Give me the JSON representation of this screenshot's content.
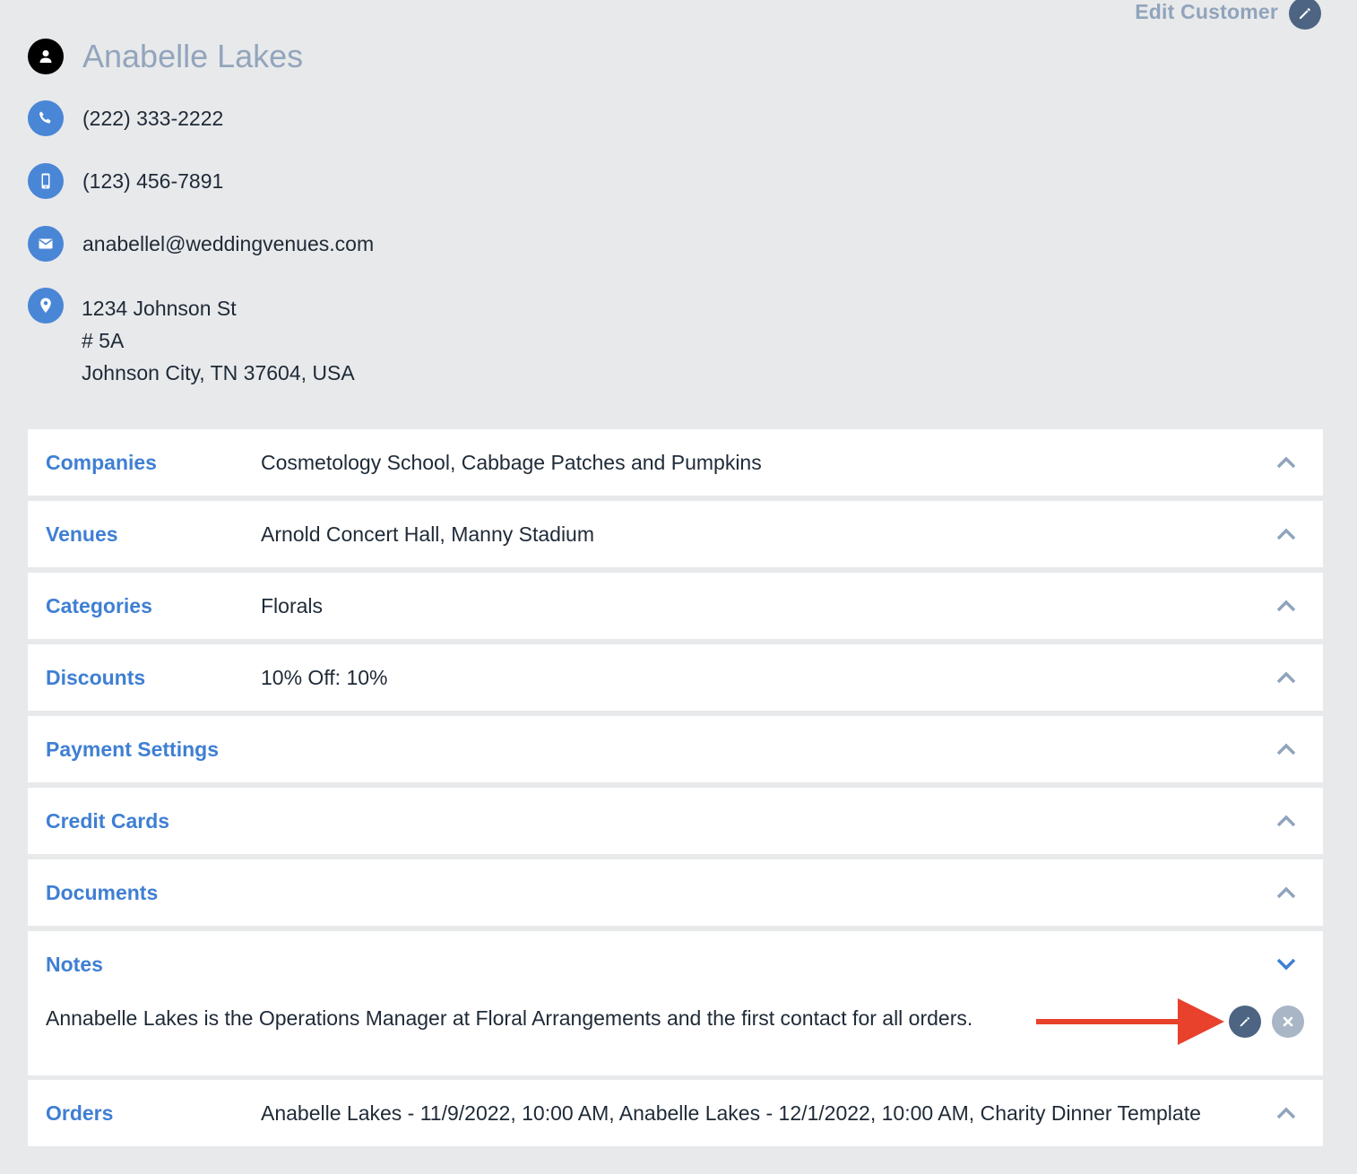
{
  "header": {
    "edit_customer_label": "Edit Customer"
  },
  "customer": {
    "name": "Anabelle Lakes",
    "phone": "(222) 333-2222",
    "mobile": "(123) 456-7891",
    "email": "anabellel@weddingvenues.com",
    "address_line1": "1234 Johnson St",
    "address_line2": "# 5A",
    "address_line3": "Johnson City, TN 37604, USA"
  },
  "sections": {
    "companies": {
      "title": "Companies",
      "value": "Cosmetology School, Cabbage Patches and Pumpkins",
      "expanded": false
    },
    "venues": {
      "title": "Venues",
      "value": "Arnold Concert Hall, Manny Stadium",
      "expanded": false
    },
    "categories": {
      "title": "Categories",
      "value": "Florals",
      "expanded": false
    },
    "discounts": {
      "title": "Discounts",
      "value": "10% Off: 10%",
      "expanded": false
    },
    "payment_settings": {
      "title": "Payment Settings",
      "value": "",
      "expanded": false
    },
    "credit_cards": {
      "title": "Credit Cards",
      "value": "",
      "expanded": false
    },
    "documents": {
      "title": "Documents",
      "value": "",
      "expanded": false
    },
    "notes": {
      "title": "Notes",
      "value": "Annabelle Lakes is the Operations Manager at Floral Arrangements and the first contact for all orders.",
      "expanded": true
    },
    "orders": {
      "title": "Orders",
      "value": "Anabelle Lakes - 11/9/2022, 10:00 AM, Anabelle Lakes - 12/1/2022, 10:00 AM, Charity Dinner Template",
      "expanded": false
    }
  },
  "colors": {
    "background": "#e8e9eb",
    "accent_blue": "#3f7fd3",
    "icon_blue": "#4a86d6",
    "muted_slate": "#4d6583",
    "annotation_red": "#e8412c"
  },
  "icons": {
    "person": "person-icon",
    "phone": "phone-icon",
    "mobile": "mobile-icon",
    "email": "email-icon",
    "location": "location-icon",
    "edit": "pencil-icon",
    "delete": "close-icon",
    "collapse": "chevron-up-icon",
    "expand": "chevron-down-icon"
  }
}
